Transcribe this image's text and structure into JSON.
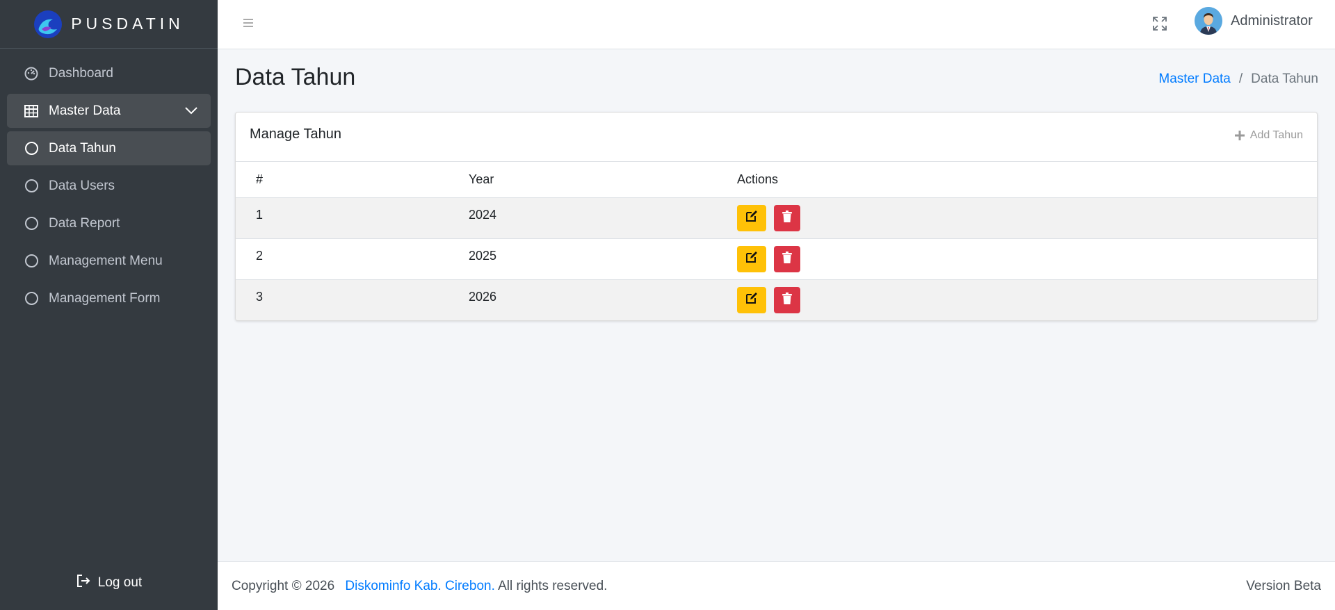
{
  "brand": {
    "name": "PUSDATIN"
  },
  "sidebar": {
    "items": [
      {
        "label": "Dashboard",
        "icon": "tachometer-icon"
      },
      {
        "label": "Master Data",
        "icon": "table-icon"
      },
      {
        "label": "Data Tahun",
        "icon": "circle-icon"
      },
      {
        "label": "Data Users",
        "icon": "circle-icon"
      },
      {
        "label": "Data Report",
        "icon": "circle-icon"
      },
      {
        "label": "Management Menu",
        "icon": "circle-icon"
      },
      {
        "label": "Management Form",
        "icon": "circle-icon"
      }
    ],
    "logout_label": "Log out"
  },
  "topbar": {
    "user_name": "Administrator"
  },
  "page": {
    "title": "Data Tahun",
    "breadcrumb": {
      "parent": "Master Data",
      "separator": "/",
      "current": "Data Tahun"
    }
  },
  "card": {
    "title": "Manage Tahun",
    "add_label": "Add Tahun",
    "columns": [
      "#",
      "Year",
      "Actions"
    ],
    "rows": [
      {
        "num": "1",
        "year": "2024"
      },
      {
        "num": "2",
        "year": "2025"
      },
      {
        "num": "3",
        "year": "2026"
      }
    ]
  },
  "footer": {
    "copyright": "Copyright © 2026",
    "org": "Diskominfo Kab. Cirebon.",
    "rights": "All rights reserved.",
    "version": "Version Beta"
  },
  "colors": {
    "sidebar_bg": "#343a40",
    "accent": "#007bff",
    "edit": "#ffc107",
    "delete": "#dc3545"
  }
}
